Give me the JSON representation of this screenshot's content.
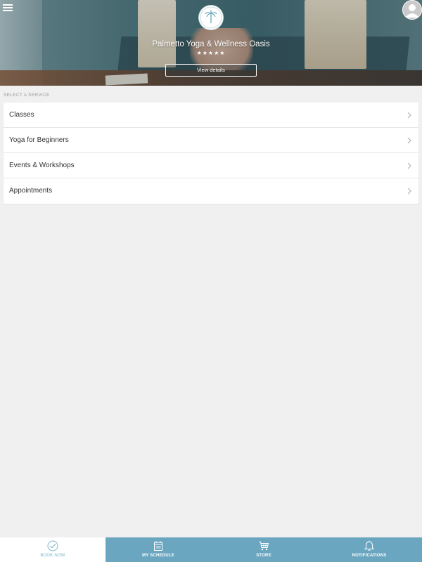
{
  "studio": {
    "name": "Palmetto Yoga & Wellness Oasis",
    "rating_stars": "★★★★★",
    "view_details_label": "View details"
  },
  "services": {
    "section_label": "SELECT A SERVICE",
    "items": [
      {
        "label": "Classes"
      },
      {
        "label": "Yoga for Beginners"
      },
      {
        "label": "Events & Workshops"
      },
      {
        "label": "Appointments"
      }
    ]
  },
  "tabbar": {
    "tabs": [
      {
        "label": "BOOK NOW",
        "icon": "check-circle-icon",
        "active": true
      },
      {
        "label": "MY SCHEDULE",
        "icon": "calendar-icon",
        "active": false
      },
      {
        "label": "STORE",
        "icon": "cart-icon",
        "active": false
      },
      {
        "label": "NOTIFICATIONS",
        "icon": "bell-icon",
        "active": false
      }
    ]
  },
  "colors": {
    "tab_bar_bg": "#6aa6c0",
    "active_tab_text": "#7fb4ca",
    "page_bg": "#f0f0f0"
  }
}
